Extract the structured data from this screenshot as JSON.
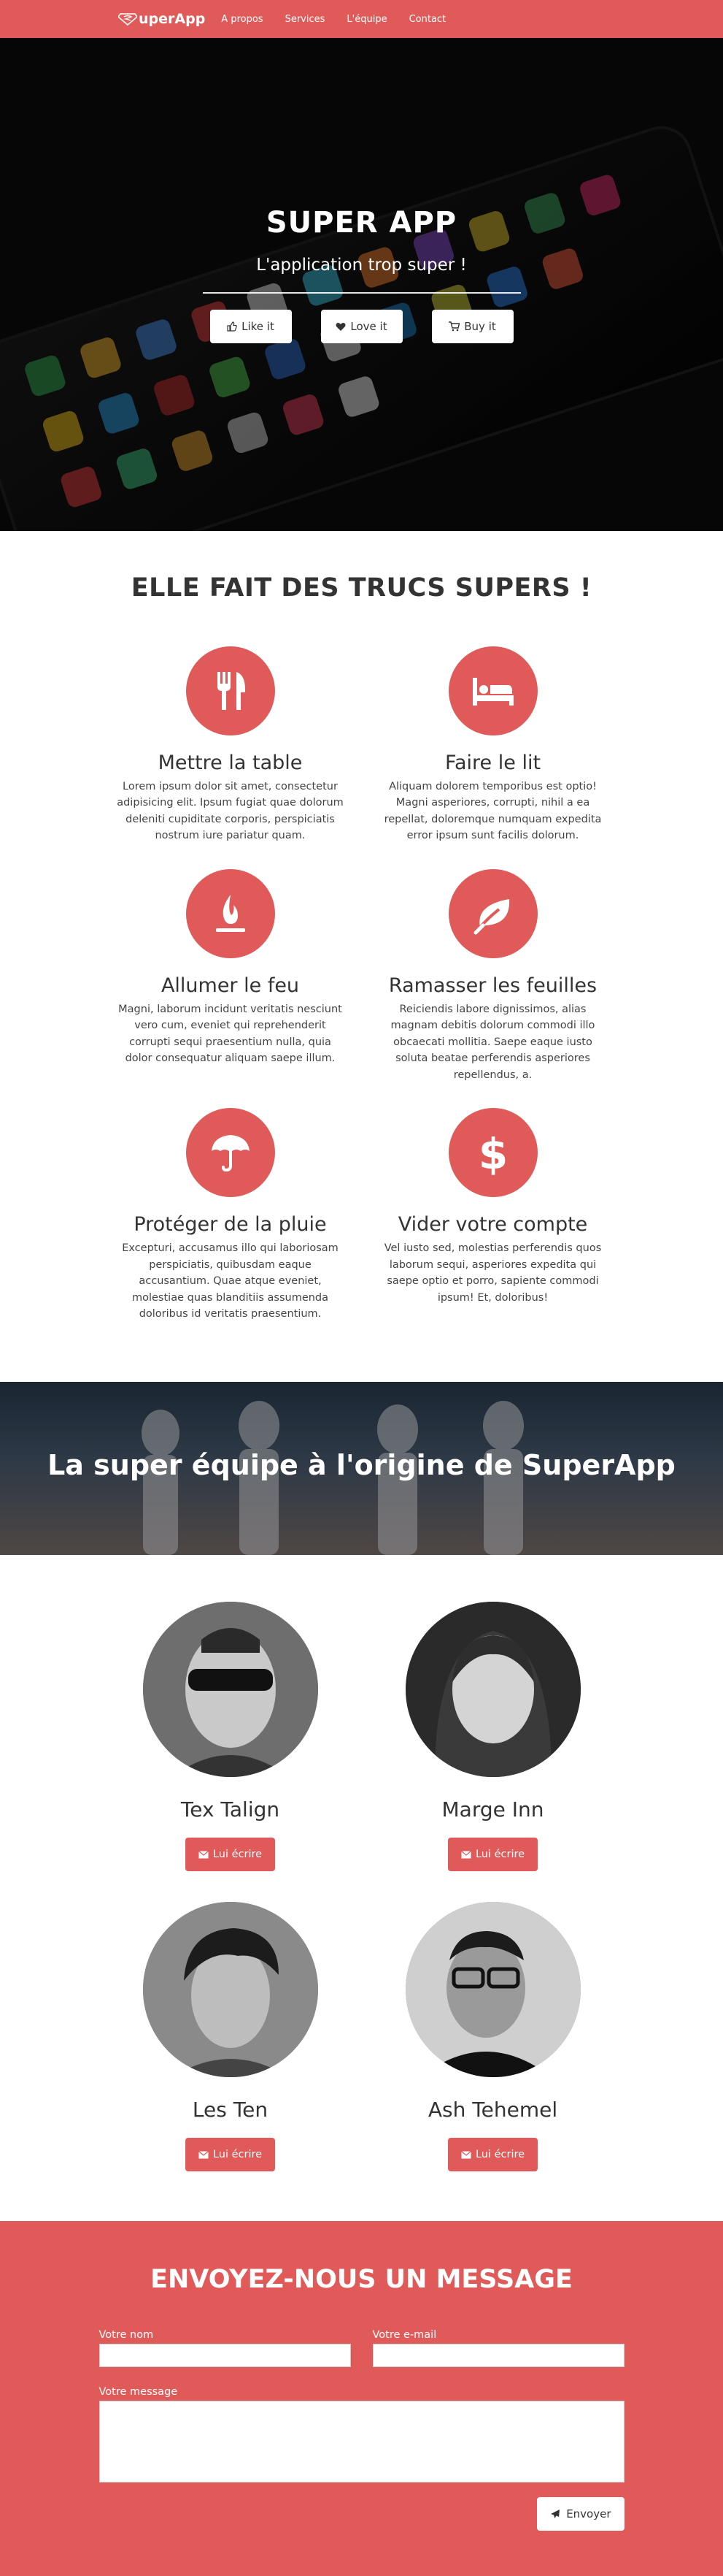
{
  "nav": {
    "brand": "uperApp",
    "links": [
      "A propos",
      "Services",
      "L'équipe",
      "Contact"
    ]
  },
  "hero": {
    "title": "SUPER APP",
    "subtitle": "L'application trop super !",
    "buttons": [
      {
        "label": "Like it",
        "icon": "thumbs-up-icon"
      },
      {
        "label": "Love it",
        "icon": "heart-icon"
      },
      {
        "label": "Buy it",
        "icon": "cart-icon"
      }
    ]
  },
  "features": {
    "title": "ELLE FAIT DES TRUCS SUPERS !",
    "items": [
      {
        "title": "Mettre la table",
        "icon": "cutlery-icon",
        "text": "Lorem ipsum dolor sit amet, consectetur adipisicing elit. Ipsum fugiat quae dolorum deleniti cupiditate corporis, perspiciatis nostrum iure pariatur quam."
      },
      {
        "title": "Faire le lit",
        "icon": "bed-icon",
        "text": "Aliquam dolorem temporibus est optio! Magni asperiores, corrupti, nihil a ea repellat, doloremque numquam expedita error ipsum sunt facilis dolorum."
      },
      {
        "title": "Allumer le feu",
        "icon": "fire-icon",
        "text": "Magni, laborum incidunt veritatis nesciunt vero cum, eveniet qui reprehenderit corrupti sequi praesentium nulla, quia dolor consequatur aliquam saepe illum."
      },
      {
        "title": "Ramasser les feuilles",
        "icon": "leaf-icon",
        "text": "Reiciendis labore dignissimos, alias magnam debitis dolorum commodi illo obcaecati mollitia. Saepe eaque iusto soluta beatae perferendis asperiores repellendus, a."
      },
      {
        "title": "Protéger de la pluie",
        "icon": "umbrella-icon",
        "text": "Excepturi, accusamus illo qui laboriosam perspiciatis, quibusdam eaque accusantium. Quae atque eveniet, molestiae quas blanditiis assumenda doloribus id veritatis praesentium."
      },
      {
        "title": "Vider votre compte",
        "icon": "dollar-icon",
        "text": "Vel iusto sed, molestias perferendis quos laborum sequi, asperiores expedita qui saepe optio et porro, sapiente commodi ipsum! Et, doloribus!"
      }
    ]
  },
  "team_banner": {
    "title": "La super équipe à l'origine de SuperApp"
  },
  "team": {
    "members": [
      {
        "name": "Tex Talign",
        "button": "Lui écrire"
      },
      {
        "name": "Marge Inn",
        "button": "Lui écrire"
      },
      {
        "name": "Les Ten",
        "button": "Lui écrire"
      },
      {
        "name": "Ash Tehemel",
        "button": "Lui écrire"
      }
    ]
  },
  "contact": {
    "title": "ENVOYEZ-NOUS UN MESSAGE",
    "name_label": "Votre nom",
    "email_label": "Votre e-mail",
    "message_label": "Votre message",
    "send_label": "Envoyer"
  },
  "colors": {
    "accent": "#e05a5a",
    "dark": "#0b0b0b",
    "text": "#333333"
  }
}
